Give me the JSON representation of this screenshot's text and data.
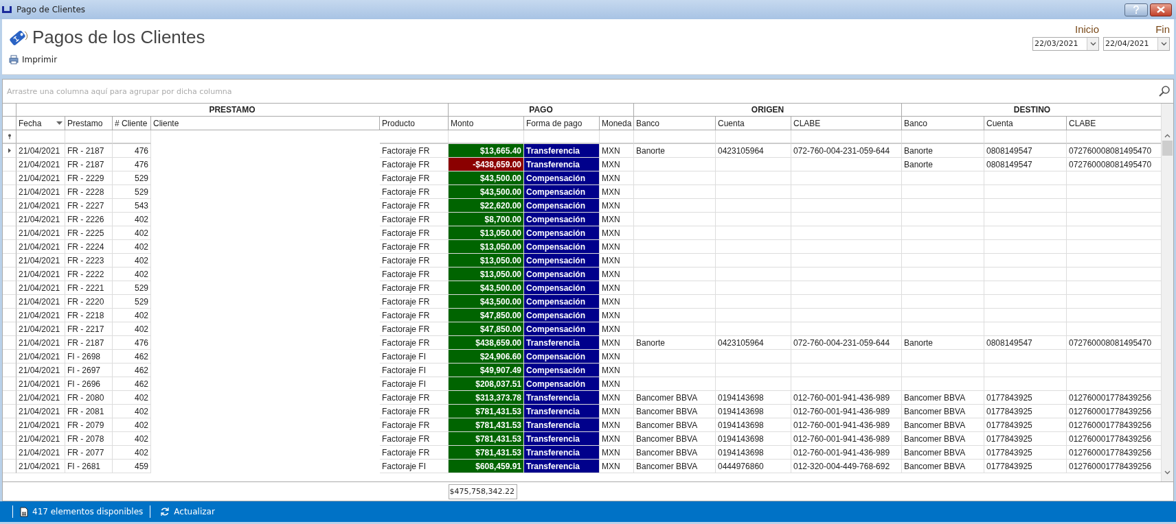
{
  "window": {
    "title": "Pago de Clientes"
  },
  "header": {
    "title": "Pagos de los Clientes",
    "print_button": "Imprimir",
    "start_label": "Inicio",
    "start_date": "22/03/2021",
    "end_label": "Fin",
    "end_date": "22/04/2021"
  },
  "group_panel": {
    "placeholder": "Arrastre una columna aquí para agrupar por dicha columna"
  },
  "table": {
    "bands": [
      {
        "label": "PRESTAMO",
        "columns": [
          "Fecha",
          "Prestamo",
          "# Cliente",
          "Cliente",
          "Producto"
        ]
      },
      {
        "label": "PAGO",
        "columns": [
          "Monto",
          "Forma de pago",
          "Moneda"
        ]
      },
      {
        "label": "ORIGEN",
        "columns": [
          "Banco",
          "Cuenta",
          "CLABE"
        ]
      },
      {
        "label": "DESTINO",
        "columns": [
          "Banco",
          "Cuenta",
          "CLABE"
        ]
      }
    ],
    "rows": [
      {
        "current": true,
        "fecha": "21/04/2021",
        "prestamo": "FR - 2187",
        "cliente_num": "476",
        "producto": "Factoraje FR",
        "monto": "$13,665.40",
        "negative": false,
        "forma": "Transferencia",
        "moneda": "MXN",
        "origen": {
          "banco": "Banorte",
          "cuenta": "0423105964",
          "clabe": "072-760-004-231-059-644"
        },
        "destino": {
          "banco": "Banorte",
          "cuenta": "0808149547",
          "clabe": "072760008081495470"
        }
      },
      {
        "current": false,
        "fecha": "21/04/2021",
        "prestamo": "FR - 2187",
        "cliente_num": "476",
        "producto": "Factoraje FR",
        "monto": "-$438,659.00",
        "negative": true,
        "forma": "Transferencia",
        "moneda": "MXN",
        "destino": {
          "banco": "Banorte",
          "cuenta": "0808149547",
          "clabe": "072760008081495470"
        }
      },
      {
        "current": false,
        "fecha": "21/04/2021",
        "prestamo": "FR - 2229",
        "cliente_num": "529",
        "producto": "Factoraje FR",
        "monto": "$43,500.00",
        "negative": false,
        "forma": "Compensación",
        "moneda": "MXN"
      },
      {
        "current": false,
        "fecha": "21/04/2021",
        "prestamo": "FR - 2228",
        "cliente_num": "529",
        "producto": "Factoraje FR",
        "monto": "$43,500.00",
        "negative": false,
        "forma": "Compensación",
        "moneda": "MXN"
      },
      {
        "current": false,
        "fecha": "21/04/2021",
        "prestamo": "FR - 2227",
        "cliente_num": "543",
        "producto": "Factoraje FR",
        "monto": "$22,620.00",
        "negative": false,
        "forma": "Compensación",
        "moneda": "MXN"
      },
      {
        "current": false,
        "fecha": "21/04/2021",
        "prestamo": "FR - 2226",
        "cliente_num": "402",
        "producto": "Factoraje FR",
        "monto": "$8,700.00",
        "negative": false,
        "forma": "Compensación",
        "moneda": "MXN"
      },
      {
        "current": false,
        "fecha": "21/04/2021",
        "prestamo": "FR - 2225",
        "cliente_num": "402",
        "producto": "Factoraje FR",
        "monto": "$13,050.00",
        "negative": false,
        "forma": "Compensación",
        "moneda": "MXN"
      },
      {
        "current": false,
        "fecha": "21/04/2021",
        "prestamo": "FR - 2224",
        "cliente_num": "402",
        "producto": "Factoraje FR",
        "monto": "$13,050.00",
        "negative": false,
        "forma": "Compensación",
        "moneda": "MXN"
      },
      {
        "current": false,
        "fecha": "21/04/2021",
        "prestamo": "FR - 2223",
        "cliente_num": "402",
        "producto": "Factoraje FR",
        "monto": "$13,050.00",
        "negative": false,
        "forma": "Compensación",
        "moneda": "MXN"
      },
      {
        "current": false,
        "fecha": "21/04/2021",
        "prestamo": "FR - 2222",
        "cliente_num": "402",
        "producto": "Factoraje FR",
        "monto": "$13,050.00",
        "negative": false,
        "forma": "Compensación",
        "moneda": "MXN"
      },
      {
        "current": false,
        "fecha": "21/04/2021",
        "prestamo": "FR - 2221",
        "cliente_num": "529",
        "producto": "Factoraje FR",
        "monto": "$43,500.00",
        "negative": false,
        "forma": "Compensación",
        "moneda": "MXN"
      },
      {
        "current": false,
        "fecha": "21/04/2021",
        "prestamo": "FR - 2220",
        "cliente_num": "529",
        "producto": "Factoraje FR",
        "monto": "$43,500.00",
        "negative": false,
        "forma": "Compensación",
        "moneda": "MXN"
      },
      {
        "current": false,
        "fecha": "21/04/2021",
        "prestamo": "FR - 2218",
        "cliente_num": "402",
        "producto": "Factoraje FR",
        "monto": "$47,850.00",
        "negative": false,
        "forma": "Compensación",
        "moneda": "MXN"
      },
      {
        "current": false,
        "fecha": "21/04/2021",
        "prestamo": "FR - 2217",
        "cliente_num": "402",
        "producto": "Factoraje FR",
        "monto": "$47,850.00",
        "negative": false,
        "forma": "Compensación",
        "moneda": "MXN"
      },
      {
        "current": false,
        "fecha": "21/04/2021",
        "prestamo": "FR - 2187",
        "cliente_num": "476",
        "producto": "Factoraje FR",
        "monto": "$438,659.00",
        "negative": false,
        "forma": "Transferencia",
        "moneda": "MXN",
        "origen": {
          "banco": "Banorte",
          "cuenta": "0423105964",
          "clabe": "072-760-004-231-059-644"
        },
        "destino": {
          "banco": "Banorte",
          "cuenta": "0808149547",
          "clabe": "072760008081495470"
        }
      },
      {
        "current": false,
        "fecha": "21/04/2021",
        "prestamo": "FI - 2698",
        "cliente_num": "462",
        "producto": "Factoraje FI",
        "monto": "$24,906.60",
        "negative": false,
        "forma": "Compensación",
        "moneda": "MXN"
      },
      {
        "current": false,
        "fecha": "21/04/2021",
        "prestamo": "FI - 2697",
        "cliente_num": "462",
        "producto": "Factoraje FI",
        "monto": "$49,907.49",
        "negative": false,
        "forma": "Compensación",
        "moneda": "MXN"
      },
      {
        "current": false,
        "fecha": "21/04/2021",
        "prestamo": "FI - 2696",
        "cliente_num": "462",
        "producto": "Factoraje FI",
        "monto": "$208,037.51",
        "negative": false,
        "forma": "Compensación",
        "moneda": "MXN"
      },
      {
        "current": false,
        "fecha": "21/04/2021",
        "prestamo": "FR - 2080",
        "cliente_num": "402",
        "producto": "Factoraje FR",
        "monto": "$313,373.78",
        "negative": false,
        "forma": "Transferencia",
        "moneda": "MXN",
        "origen": {
          "banco": "Bancomer BBVA",
          "cuenta": "0194143698",
          "clabe": "012-760-001-941-436-989"
        },
        "destino": {
          "banco": "Bancomer BBVA",
          "cuenta": "0177843925",
          "clabe": "012760001778439256"
        }
      },
      {
        "current": false,
        "fecha": "21/04/2021",
        "prestamo": "FR - 2081",
        "cliente_num": "402",
        "producto": "Factoraje FR",
        "monto": "$781,431.53",
        "negative": false,
        "forma": "Transferencia",
        "moneda": "MXN",
        "origen": {
          "banco": "Bancomer BBVA",
          "cuenta": "0194143698",
          "clabe": "012-760-001-941-436-989"
        },
        "destino": {
          "banco": "Bancomer BBVA",
          "cuenta": "0177843925",
          "clabe": "012760001778439256"
        }
      },
      {
        "current": false,
        "fecha": "21/04/2021",
        "prestamo": "FR - 2079",
        "cliente_num": "402",
        "producto": "Factoraje FR",
        "monto": "$781,431.53",
        "negative": false,
        "forma": "Transferencia",
        "moneda": "MXN",
        "origen": {
          "banco": "Bancomer BBVA",
          "cuenta": "0194143698",
          "clabe": "012-760-001-941-436-989"
        },
        "destino": {
          "banco": "Bancomer BBVA",
          "cuenta": "0177843925",
          "clabe": "012760001778439256"
        }
      },
      {
        "current": false,
        "fecha": "21/04/2021",
        "prestamo": "FR - 2078",
        "cliente_num": "402",
        "producto": "Factoraje FR",
        "monto": "$781,431.53",
        "negative": false,
        "forma": "Transferencia",
        "moneda": "MXN",
        "origen": {
          "banco": "Bancomer BBVA",
          "cuenta": "0194143698",
          "clabe": "012-760-001-941-436-989"
        },
        "destino": {
          "banco": "Bancomer BBVA",
          "cuenta": "0177843925",
          "clabe": "012760001778439256"
        }
      },
      {
        "current": false,
        "fecha": "21/04/2021",
        "prestamo": "FR - 2077",
        "cliente_num": "402",
        "producto": "Factoraje FR",
        "monto": "$781,431.53",
        "negative": false,
        "forma": "Transferencia",
        "moneda": "MXN",
        "origen": {
          "banco": "Bancomer BBVA",
          "cuenta": "0194143698",
          "clabe": "012-760-001-941-436-989"
        },
        "destino": {
          "banco": "Bancomer BBVA",
          "cuenta": "0177843925",
          "clabe": "012760001778439256"
        }
      },
      {
        "current": false,
        "fecha": "21/04/2021",
        "prestamo": "FI - 2681",
        "cliente_num": "459",
        "producto": "Factoraje FI",
        "monto": "$608,459.91",
        "negative": false,
        "forma": "Transferencia",
        "moneda": "MXN",
        "origen": {
          "banco": "Bancomer BBVA",
          "cuenta": "0444976860",
          "clabe": "012-320-004-449-768-692"
        },
        "destino": {
          "banco": "Bancomer BBVA",
          "cuenta": "0177843925",
          "clabe": "012760001778439256"
        }
      }
    ],
    "total": "$475,758,342.22"
  },
  "status_bar": {
    "count": "417 elementos disponibles",
    "refresh": "Actualizar"
  }
}
